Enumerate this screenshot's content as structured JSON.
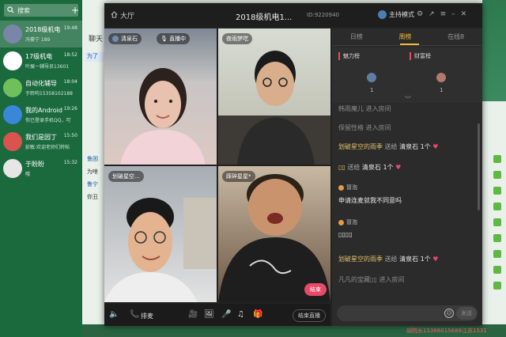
{
  "qq": {
    "search_placeholder": "搜索",
    "contacts": [
      {
        "name": "2018级机电",
        "sub": "冯豪宁 189",
        "time": "19:48",
        "color": "#7a86a8",
        "active": true
      },
      {
        "name": "17级机电",
        "sub": "叶展一辅导员13601",
        "time": "18:52",
        "color": "#ffffff"
      },
      {
        "name": "自动化辅导",
        "sub": "于聆昀15358102188",
        "time": "18:04",
        "color": "#6fbf5a"
      },
      {
        "name": "我的Android",
        "sub": "你已登录手机QQ，可",
        "time": "19:26",
        "color": "#3a86d9"
      },
      {
        "name": "我们是园丁",
        "sub": "彭敏:欢迎老师们转帖",
        "time": "15:50",
        "color": "#d9534f"
      },
      {
        "name": "于盼盼",
        "sub": "哦",
        "time": "15:32",
        "color": "#e6e6e6"
      }
    ]
  },
  "chat": {
    "title_frag": "聊天",
    "tab_frag": "为了",
    "frag1": "鲁困",
    "frag2": "为啥",
    "frag3": "鲁宁",
    "frag4": "你丑",
    "bottom_text": "胡院长15366015689江苏1531"
  },
  "yy": {
    "hall_label": "大厅",
    "title": "2018级机电1...",
    "channel_id": "ID:9220940",
    "mode_label": "主持模式",
    "tiles": [
      {
        "label": "清泉石",
        "live": "直播中"
      },
      {
        "label": "夜雨梦呓"
      },
      {
        "label": "划破星空..."
      },
      {
        "label": "踩碎星星*"
      }
    ],
    "end_button": "结束",
    "toolbar": {
      "mic_label": "排麦",
      "end_live_label": "结束直播"
    },
    "rank": {
      "tabs": [
        "日榜",
        "周榜",
        "在线8"
      ],
      "col1": "魅力榜",
      "col2": "财富榜",
      "v1": "1",
      "v2": "1"
    },
    "messages": {
      "m0": "保留性格 进入房间",
      "m1_user": "划破星空的雨季",
      "m1_act": "送给",
      "m1_tgt": "清泉石 1个",
      "m2_user": "▯▯",
      "m2_act": "送给",
      "m2_tgt": "清泉石 1个",
      "m3_speaker": "冒泡",
      "m3_text": "申请连麦就我不同意吗",
      "m4_speaker": "冒泡",
      "m4_text": "▯▯▯▯",
      "m5_user": "划破星空的雨季",
      "m5_act": "送给",
      "m5_tgt": "清泉石 1个",
      "m6": "凡凡的宝藏▯▯ 进入房间",
      "top_partial": "韩雨魔儿 进入房间"
    },
    "send_label": "发送"
  }
}
